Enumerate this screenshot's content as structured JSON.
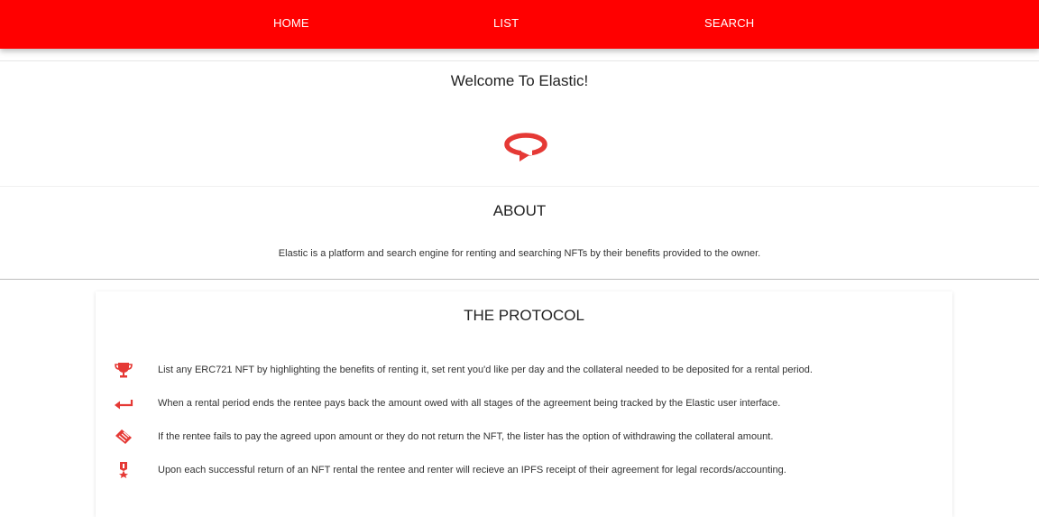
{
  "nav": {
    "home": "HOME",
    "list": "LIST",
    "search": "SEARCH"
  },
  "hero": {
    "title": "Welcome To Elastic!",
    "logo_icon": "elastic-loop-icon"
  },
  "about": {
    "title": "ABOUT",
    "text": "Elastic is a platform and search engine for renting and searching NFTs by their benefits provided to the owner."
  },
  "protocol": {
    "title": "THE PROTOCOL",
    "items": [
      {
        "icon": "trophy-icon",
        "text": "List any ERC721 NFT by highlighting the benefits of renting it, set rent you'd like per day and the collateral needed to be deposited for a rental period."
      },
      {
        "icon": "return-arrow-icon",
        "text": "When a rental period ends the rentee pays back the amount owed with all stages of the agreement being tracked by the Elastic user interface."
      },
      {
        "icon": "handshake-icon",
        "text": "If the rentee fails to pay the agreed upon amount or they do not return the NFT, the lister has the option of withdrawing the collateral amount."
      },
      {
        "icon": "award-icon",
        "text": "Upon each successful return of an NFT rental the rentee and renter will recieve an IPFS receipt of their agreement for legal records/accounting."
      }
    ]
  },
  "colors": {
    "brand": "#ff0000",
    "accent": "#e53935"
  }
}
